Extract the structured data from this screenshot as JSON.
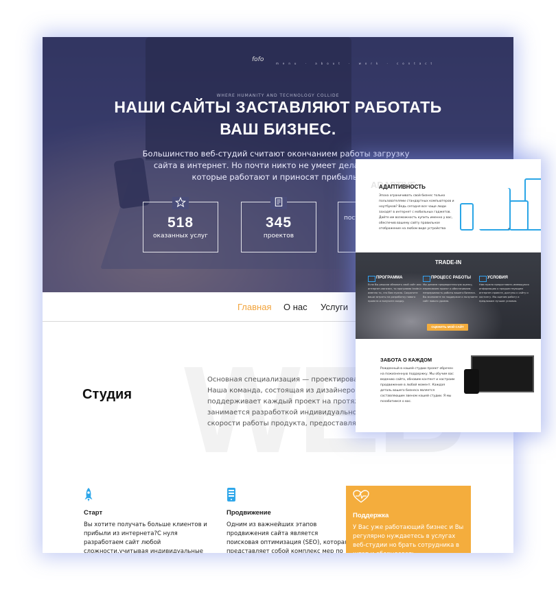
{
  "hero": {
    "logo": "fofo",
    "nav_mini": "menu · about · work · contact",
    "kicker": "WHERE HUMANITY AND TECHNOLOGY COLLIDE",
    "title_line1": "НАШИ САЙТЫ ЗАСТАВЛЯЮТ РАБОТАТЬ",
    "title_line2": "ВАШ БИЗНЕС.",
    "lead": "Большинство веб-студий считают окончанием работы загрузку сайта в интернет. Но почти никто не умеет делать сайты, которые работают и приносят прибыль.",
    "stats": [
      {
        "value": "518",
        "label": "оказанных услуг",
        "icon": "star-icon"
      },
      {
        "value": "345",
        "label": "проектов",
        "icon": "document-icon"
      },
      {
        "value": "",
        "label": "пост",
        "icon": ""
      }
    ]
  },
  "nav": {
    "items": [
      {
        "label": "Главная",
        "active": true
      },
      {
        "label": "О нас",
        "active": false
      },
      {
        "label": "Услуги",
        "active": false
      }
    ]
  },
  "studio": {
    "bg_word": "WEB",
    "title": "Студия",
    "text": "Основная специализация — проектирование с Наша команда, состоящая из дизайнеров, мар поддерживает каждый проект на протяжении в занимается разработкой индивидуального диз скорости работы продукта, предоставляет услу"
  },
  "features": [
    {
      "icon": "rocket-icon",
      "title": "Старт",
      "text": "Вы хотите получать больше клиентов и прибыли из интернета?С нуля разработаем сайт любой сложности,учитывая индивидуальные особенности вашего бизнеса. Стоимость создания"
    },
    {
      "icon": "phone-list-icon",
      "title": "Продвижение",
      "text": "Одним из важнейших этапов продвижения сайта является поисковая оптимизация (SEO), которая представляет собой комплекс мер по повышению позиции сайта в поисковых"
    },
    {
      "icon": "heart-pulse-icon",
      "title": "Поддержка",
      "text": "У Вас уже работающий бизнес и Вы регулярно нуждаетесь в услугах веб-студии но брать сотрудника в штат и оборудовать дополнительное рабочее место не выгодно?"
    }
  ],
  "card": {
    "adaptive": {
      "ghost": "ADAPTIVE",
      "title": "АДАПТИВНОСТЬ",
      "text": "Эпоха ограничивать свой бизнес только пользователями стандартных компьютеров и ноутбуков? Ведь сегодня все чаще люди заходят в интернет с мобильных гаджетов. Дайте им возможность купить именно у вас, обеспечив вашему сайту правильное отображение на любом виде устройства"
    },
    "tradein": {
      "title": "TRADE-IN",
      "cols": [
        {
          "title": "ПРОГРАММА",
          "text": "Если Вы решили обновить свой сайт или интернет-магазин, то программа trade-in именно то, что Вам нужно. Сократите ваши затраты на разработку нового проекта и получите скидку."
        },
        {
          "title": "ПРОЦЕСС РАБОТЫ",
          "text": "Мы делаем предварительную оценку, перенимаем проект и обеспечиваем непрерывность работы вашего бизнеса. Вы экономите на поддержке и получаете сайт нового уровня."
        },
        {
          "title": "УСЛОВИЯ",
          "text": "Нам нужно предоставить имеющуюся информацию о предшествующем интернет-проекте, доступы к сайту и хостингу. Мы оценим работу и предложим лучшие условия."
        }
      ],
      "button": "ОЦЕНИТЬ МОЙ САЙТ",
      "accent": "#f4ad3d"
    },
    "care": {
      "title": "ЗАБОТА О КАЖДОМ",
      "text": "Рожденный в нашей студии проект обречен на пожизненную поддержку. Мы обучим вас ведению сайта, обновим контент и настроим продвижение в любой момент. Каждая деталь вашего бизнеса является составляющим звеном нашей студии. Я мы позаботимся о вас."
    }
  }
}
